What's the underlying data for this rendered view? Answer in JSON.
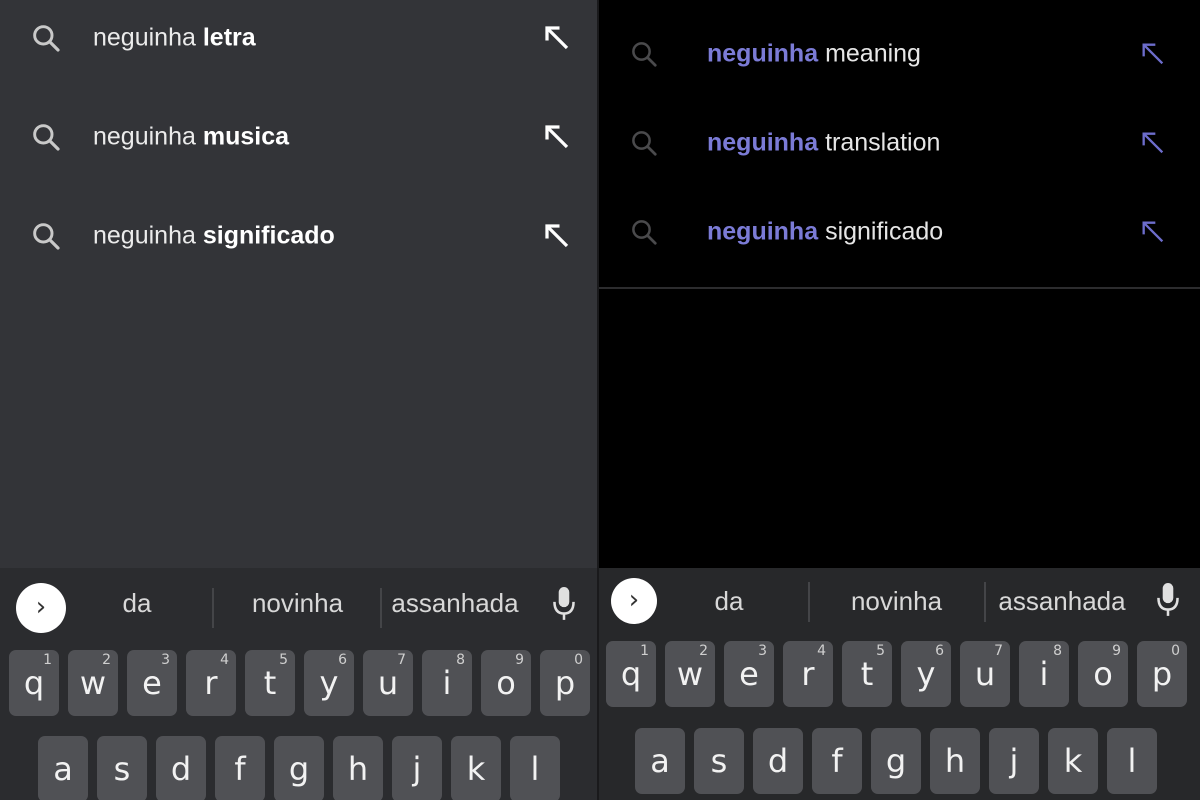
{
  "left_panel": {
    "suggestions": [
      {
        "base": "neguinha",
        "completion": "letra"
      },
      {
        "base": "neguinha",
        "completion": "musica"
      },
      {
        "base": "neguinha",
        "completion": "significado"
      }
    ],
    "keyboard": {
      "words": [
        "da",
        "novinha",
        "assanhada"
      ],
      "row1": [
        {
          "key": "q",
          "hint": "1"
        },
        {
          "key": "w",
          "hint": "2"
        },
        {
          "key": "e",
          "hint": "3"
        },
        {
          "key": "r",
          "hint": "4"
        },
        {
          "key": "t",
          "hint": "5"
        },
        {
          "key": "y",
          "hint": "6"
        },
        {
          "key": "u",
          "hint": "7"
        },
        {
          "key": "i",
          "hint": "8"
        },
        {
          "key": "o",
          "hint": "9"
        },
        {
          "key": "p",
          "hint": "0"
        }
      ],
      "row2": [
        "a",
        "s",
        "d",
        "f",
        "g",
        "h",
        "j",
        "k",
        "l"
      ]
    }
  },
  "right_panel": {
    "suggestions": [
      {
        "base": "neguinha",
        "completion": "meaning"
      },
      {
        "base": "neguinha",
        "completion": "translation"
      },
      {
        "base": "neguinha",
        "completion": "significado"
      }
    ],
    "keyboard": {
      "words": [
        "da",
        "novinha",
        "assanhada"
      ],
      "row1": [
        {
          "key": "q",
          "hint": "1"
        },
        {
          "key": "w",
          "hint": "2"
        },
        {
          "key": "e",
          "hint": "3"
        },
        {
          "key": "r",
          "hint": "4"
        },
        {
          "key": "t",
          "hint": "5"
        },
        {
          "key": "y",
          "hint": "6"
        },
        {
          "key": "u",
          "hint": "7"
        },
        {
          "key": "i",
          "hint": "8"
        },
        {
          "key": "o",
          "hint": "9"
        },
        {
          "key": "p",
          "hint": "0"
        }
      ],
      "row2": [
        "a",
        "s",
        "d",
        "f",
        "g",
        "h",
        "j",
        "k",
        "l"
      ]
    }
  },
  "icons": {
    "search": "search-icon",
    "fill_query": "arrow-up-left-icon",
    "expand": "chevron-right-icon",
    "mic": "mic-icon"
  },
  "colors": {
    "left_background": "#333438",
    "right_background": "#000000",
    "highlight": "#7b7bd6",
    "key": "#505155"
  }
}
